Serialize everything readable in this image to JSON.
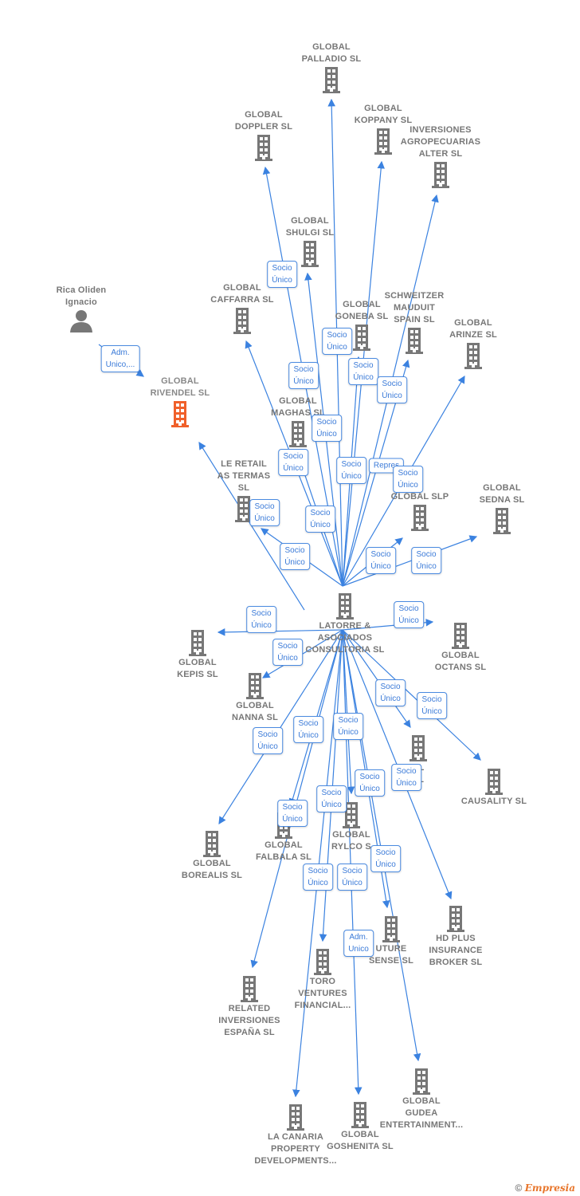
{
  "colors": {
    "edge": "#3b82e0",
    "building": "#777777",
    "highlight": "#f0602a",
    "label": "#777777"
  },
  "center": {
    "name": "LATORRE &\nASOCIADOS\nCONSULTORIA SL",
    "icon": "building-icon"
  },
  "person": {
    "name": "Rica Oliden\nIgnacio",
    "icon": "person-icon"
  },
  "highlight": {
    "name": "GLOBAL\nRIVENDEL SL",
    "icon": "building-icon"
  },
  "companies": [
    "GLOBAL\nPALLADIO SL",
    "GLOBAL\nDOPPLER SL",
    "GLOBAL\nKOPPANY SL",
    "INVERSIONES\nAGROPECUARIAS\nALTER SL",
    "GLOBAL\nSHULGI SL",
    "GLOBAL\nCAFFARRA SL",
    "GLOBAL\nGONEBA SL",
    "SCHWEITZER\nMAUDUIT\nSPAIN SL",
    "GLOBAL\nARINZE SL",
    "GLOBAL\nMAGHAS SL",
    "LE RETAIL\nAS TERMAS\nSL",
    "A\nGLOBAL SLP",
    "GLOBAL\nSEDNA SL",
    "GLOBAL\nKEPIS SL",
    "GLOBAL\nOCTANS SL",
    "GLOBAL\nNANNA SL",
    "AL\nSL",
    "CAUSALITY SL",
    "GLOBAL\nBOREALIS SL",
    "GLOBAL\nFALBALA SL",
    "GLOBAL\nRYLCO S",
    "HD PLUS\nINSURANCE\nBROKER SL",
    "UTURE\nSENSE SL",
    "TORO\nVENTURES\nFINANCIAL...",
    "RELATED\nINVERSIONES\nESPAÑA SL",
    "GLOBAL\nGUDEA\nENTERTAINMENT...",
    "LA CANARIA\nPROPERTY\nDEVELOPMENTS...",
    "GLOBAL\nGOSHENITA SL"
  ],
  "edge_labels": {
    "socio": "Socio\nÚnico",
    "adm_person": "Adm.\nUnico,...",
    "adm": "Adm.\nUnico",
    "repres": "Repres"
  },
  "footer": {
    "copyright": "©",
    "brand": "Empresia"
  }
}
